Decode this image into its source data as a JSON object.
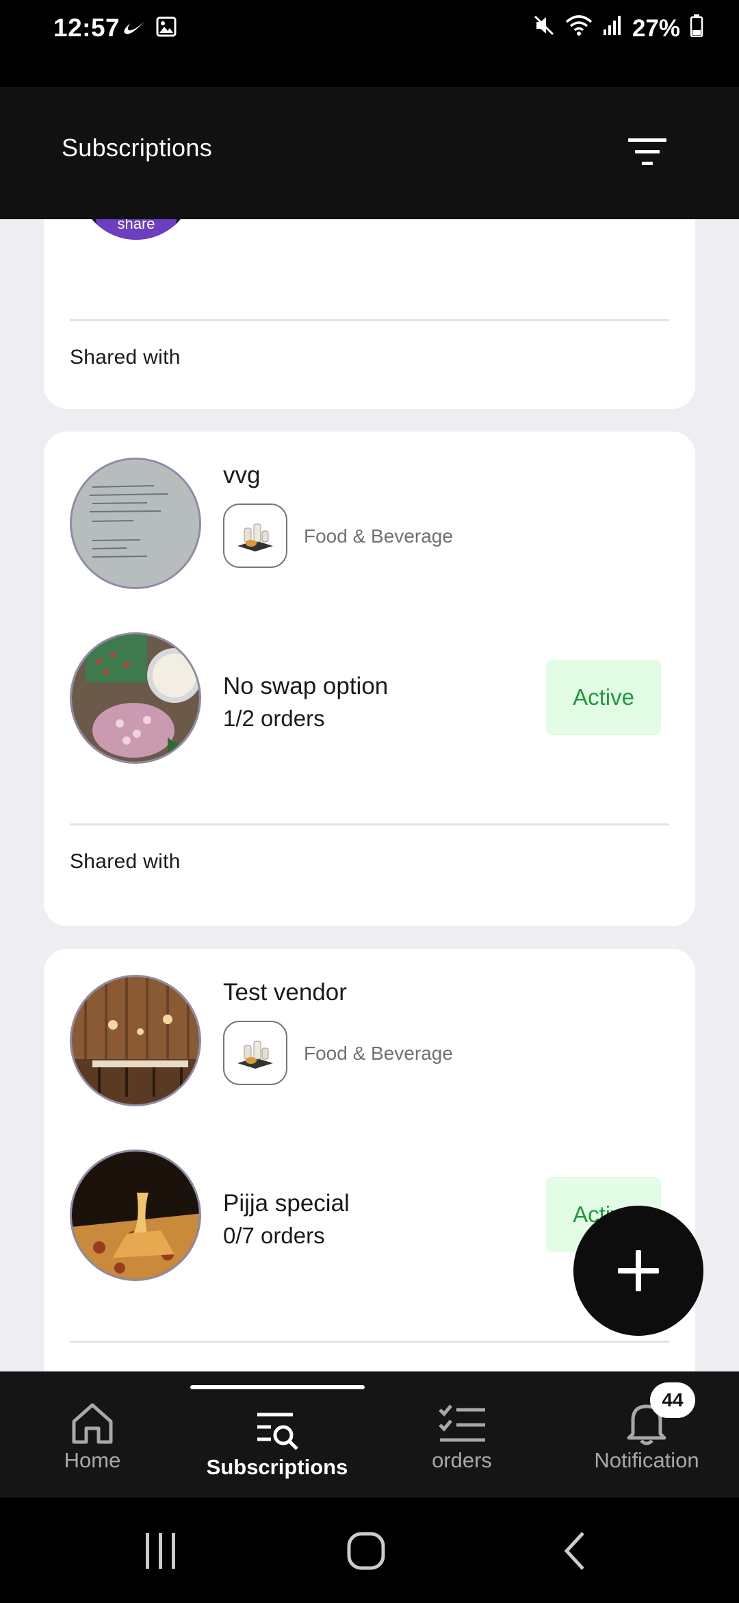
{
  "status_bar": {
    "time": "12:57",
    "battery": "27%",
    "left_icons": [
      "nike-swoosh-icon",
      "gallery-icon"
    ],
    "right_icons": [
      "mute-icon",
      "wifi-icon",
      "signal-icon",
      "battery-icon"
    ]
  },
  "app_bar": {
    "title": "Subscriptions",
    "filter_icon": "filter-icon"
  },
  "cards": [
    {
      "partial": true,
      "avatar_caption": "share",
      "shared_label": "Shared with"
    },
    {
      "vendor_name": "vvg",
      "category": "Food & Beverage",
      "plan_name": "No swap option",
      "orders": "1/2 orders",
      "status": "Active",
      "shared_label": "Shared with"
    },
    {
      "vendor_name": "Test vendor",
      "category": "Food & Beverage",
      "plan_name": "Pijja special",
      "orders": "0/7 orders",
      "status": "Active"
    }
  ],
  "fab": {
    "icon": "plus-icon"
  },
  "bottom_nav": {
    "items": [
      {
        "label": "Home",
        "icon": "home-icon"
      },
      {
        "label": "Subscriptions",
        "icon": "subscriptions-search-icon",
        "active": true
      },
      {
        "label": "orders",
        "icon": "checklist-icon"
      },
      {
        "label": "Notification",
        "icon": "bell-icon",
        "badge": "44"
      }
    ]
  },
  "colors": {
    "active_bg": "#e3fce6",
    "active_text": "#1f9a3d",
    "content_bg": "#eeedf2",
    "bar_bg": "#111112"
  }
}
